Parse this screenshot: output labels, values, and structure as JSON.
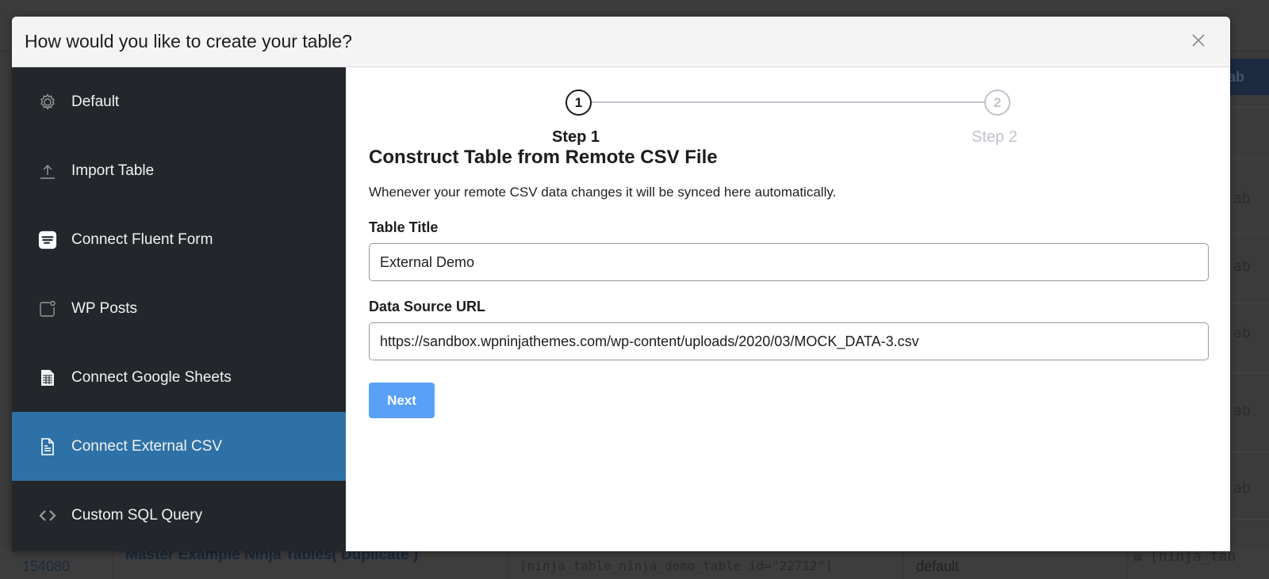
{
  "modal": {
    "title": "How would you like to create your table?",
    "close_icon": "close-icon"
  },
  "sidebar": {
    "active_index": 5,
    "items": [
      {
        "label": "Default",
        "icon": "gear-icon"
      },
      {
        "label": "Import Table",
        "icon": "upload-icon"
      },
      {
        "label": "Connect Fluent Form",
        "icon": "fluent-form-icon"
      },
      {
        "label": "WP Posts",
        "icon": "post-icon"
      },
      {
        "label": "Connect Google Sheets",
        "icon": "spreadsheet-icon"
      },
      {
        "label": "Connect External CSV",
        "icon": "document-icon"
      },
      {
        "label": "Custom SQL Query",
        "icon": "code-icon"
      }
    ]
  },
  "steps": {
    "current": 1,
    "items": [
      {
        "number": "1",
        "label": "Step 1"
      },
      {
        "number": "2",
        "label": "Step 2"
      }
    ]
  },
  "form": {
    "title": "Construct Table from Remote CSV File",
    "description": "Whenever your remote CSV data changes it will be synced here automatically.",
    "table_title_label": "Table Title",
    "table_title_value": "External Demo",
    "url_label": "Data Source URL",
    "url_value": "https://sandbox.wpninjathemes.com/wp-content/uploads/2020/03/MOCK_DATA-3.csv",
    "next_label": "Next"
  },
  "background": {
    "button_fragment": "ab",
    "cell_fragment": "ab",
    "row_id": "154080",
    "row_title": "Master Example Ninja Tables( Duplicate )",
    "row_shortcode": "[ninja_table_ninja_demo_table id=\"22712\"]",
    "row_type": "default",
    "row_shortcode2": "[ninja_tab"
  },
  "colors": {
    "sidebar_bg": "#23262b",
    "active_item": "#2e71a6",
    "next_button": "#58a0f8",
    "step_inactive": "#c0c4cc"
  }
}
